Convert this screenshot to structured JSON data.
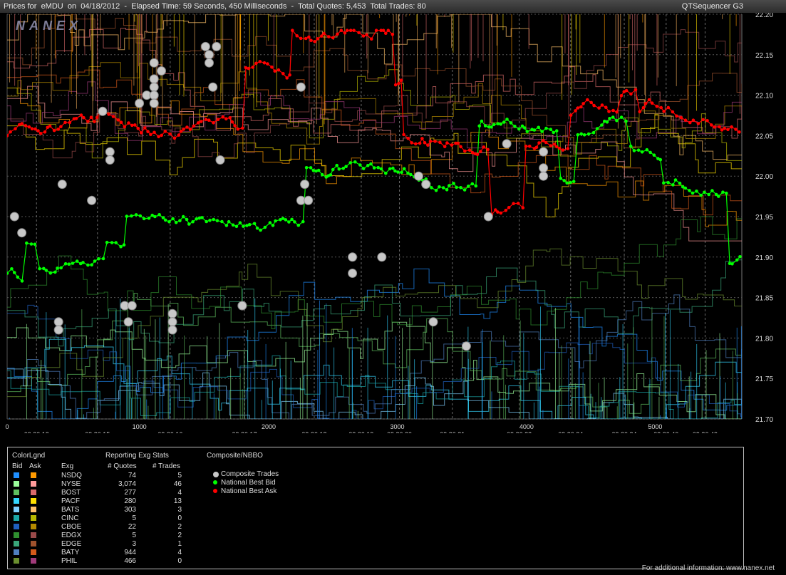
{
  "header": {
    "title": "Prices for  eMDU  on  04/18/2012  -  Elapsed Time: 59 Seconds, 450 Milliseconds  -  Total Quotes: 5,453  Total Trades: 80",
    "sequencer": "QTSequencer G3"
  },
  "logo": "NANEX",
  "chart_data": {
    "type": "line",
    "y_ticks": [
      22.2,
      22.15,
      22.1,
      22.05,
      22.0,
      21.95,
      21.9,
      21.85,
      21.8,
      21.75,
      21.7
    ],
    "ylim": [
      21.7,
      22.2
    ],
    "x_seq_ticks": [
      "0",
      "1000",
      "2000",
      "3000",
      "4000",
      "5000"
    ],
    "x_time_labels": [
      "09:30:12",
      "09:30:15",
      "09:30:16",
      "09:30:17",
      "09:30:18",
      "09:30:19",
      "09:30:20",
      "09:30:21",
      "09:30:23",
      "09:30:24",
      "09:30:34",
      "09:30:40",
      "09:30:49"
    ],
    "series": [
      {
        "name": "Composite Trades",
        "points": [
          [
            0.01,
            21.95
          ],
          [
            0.02,
            21.93
          ],
          [
            0.07,
            21.82
          ],
          [
            0.07,
            21.81
          ],
          [
            0.075,
            21.99
          ],
          [
            0.115,
            21.97
          ],
          [
            0.13,
            22.08
          ],
          [
            0.14,
            22.03
          ],
          [
            0.14,
            22.02
          ],
          [
            0.16,
            21.84
          ],
          [
            0.165,
            21.82
          ],
          [
            0.17,
            21.84
          ],
          [
            0.18,
            22.09
          ],
          [
            0.19,
            22.1
          ],
          [
            0.2,
            22.14
          ],
          [
            0.2,
            22.12
          ],
          [
            0.2,
            22.11
          ],
          [
            0.2,
            22.1
          ],
          [
            0.2,
            22.09
          ],
          [
            0.21,
            22.13
          ],
          [
            0.225,
            21.83
          ],
          [
            0.225,
            21.82
          ],
          [
            0.225,
            21.81
          ],
          [
            0.27,
            22.16
          ],
          [
            0.275,
            22.15
          ],
          [
            0.275,
            22.14
          ],
          [
            0.285,
            22.16
          ],
          [
            0.28,
            22.11
          ],
          [
            0.29,
            22.02
          ],
          [
            0.32,
            21.84
          ],
          [
            0.32,
            21.84
          ],
          [
            0.4,
            22.11
          ],
          [
            0.4,
            21.97
          ],
          [
            0.405,
            21.99
          ],
          [
            0.41,
            21.97
          ],
          [
            0.47,
            21.9
          ],
          [
            0.47,
            21.88
          ],
          [
            0.51,
            21.9
          ],
          [
            0.56,
            22.0
          ],
          [
            0.57,
            21.99
          ],
          [
            0.58,
            21.82
          ],
          [
            0.625,
            21.79
          ],
          [
            0.655,
            21.95
          ],
          [
            0.68,
            22.04
          ],
          [
            0.73,
            22.03
          ],
          [
            0.73,
            22.01
          ],
          [
            0.73,
            22.0
          ]
        ]
      },
      {
        "name": "National Best Bid",
        "color": "#00ff00"
      },
      {
        "name": "National Best Ask",
        "color": "#ff0000"
      }
    ]
  },
  "legend": {
    "header_colorlgnd": "ColorLgnd",
    "header_stats": "Reporting Exg Stats",
    "header_composite": "Composite/NBBO",
    "col_bid": "Bid",
    "col_ask": "Ask",
    "col_exg": "Exg",
    "col_quotes": "# Quotes",
    "col_trades": "# Trades",
    "rows": [
      {
        "exg": "NSDQ",
        "quotes": "74",
        "trades": "5",
        "bid_color": "#1f8fff",
        "ask_color": "#ff9a00"
      },
      {
        "exg": "NYSE",
        "quotes": "3,074",
        "trades": "46",
        "bid_color": "#9cff9c",
        "ask_color": "#ff9a9a"
      },
      {
        "exg": "BOST",
        "quotes": "277",
        "trades": "4",
        "bid_color": "#5fbf5f",
        "ask_color": "#d96a6a"
      },
      {
        "exg": "PACF",
        "quotes": "280",
        "trades": "13",
        "bid_color": "#33d6ff",
        "ask_color": "#ffe000"
      },
      {
        "exg": "BATS",
        "quotes": "303",
        "trades": "3",
        "bid_color": "#7fd0ff",
        "ask_color": "#ffc06a"
      },
      {
        "exg": "CINC",
        "quotes": "5",
        "trades": "0",
        "bid_color": "#1aa6a6",
        "ask_color": "#b8b800"
      },
      {
        "exg": "CBOE",
        "quotes": "22",
        "trades": "2",
        "bid_color": "#1f5fbf",
        "ask_color": "#b48a00"
      },
      {
        "exg": "EDGX",
        "quotes": "5",
        "trades": "2",
        "bid_color": "#2f8f2f",
        "ask_color": "#9a4a4a"
      },
      {
        "exg": "EDGE",
        "quotes": "3",
        "trades": "1",
        "bid_color": "#3aa67a",
        "ask_color": "#a0522d"
      },
      {
        "exg": "BATY",
        "quotes": "944",
        "trades": "4",
        "bid_color": "#4f7fbf",
        "ask_color": "#d45a1a"
      },
      {
        "exg": "PHIL",
        "quotes": "466",
        "trades": "0",
        "bid_color": "#6b8f2f",
        "ask_color": "#a03a7a"
      }
    ],
    "composite": [
      {
        "label": "Composite Trades",
        "color": "#c8c8c8"
      },
      {
        "label": "National Best Bid",
        "color": "#00ff00"
      },
      {
        "label": "National Best Ask",
        "color": "#ff0000"
      }
    ]
  },
  "footer": "For additional information: www.nanex.net"
}
